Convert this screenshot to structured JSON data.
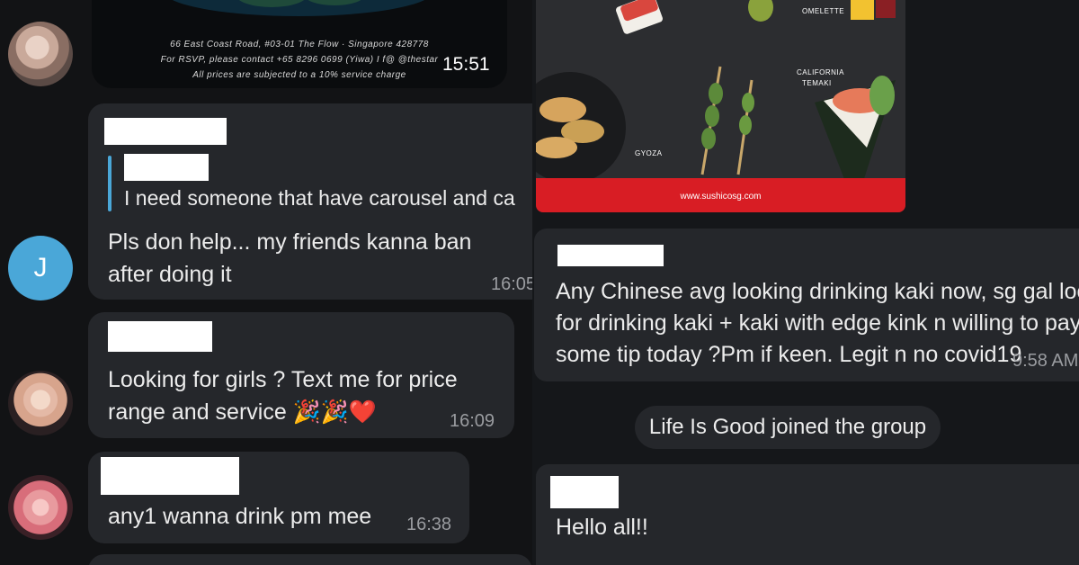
{
  "left_chat": {
    "media_card": {
      "address": "66 East Coast Road, #03-01 The Flow · Singapore 428778",
      "rsvp": "For RSVP, please contact +65 8296 0699 (Yiwa) I f@ @thestar",
      "service_charge": "All prices are subjected to a 10% service charge",
      "time": "15:51"
    },
    "messages": [
      {
        "avatar_letter": "J",
        "quote_text": "I need someone that have carousel and ca",
        "line1": "Pls don help... my friends kanna ban",
        "line2": "after doing it",
        "time": "16:05"
      },
      {
        "line1": "Looking for girls ? Text me for price",
        "line2": "range and service 🎉🎉❤️",
        "time": "16:09"
      },
      {
        "line1": "any1 wanna drink pm mee",
        "time": "16:38"
      }
    ]
  },
  "right_chat": {
    "poster": {
      "label_omelette": "OMELETTE",
      "label_california": "CALIFORNIA",
      "label_temaki": "TEMAKI",
      "label_gyoza": "GYOZA",
      "url": "www.sushicosg.com"
    },
    "message1": {
      "line1": "Any Chinese avg looking drinking kaki now, sg gal looking",
      "line2": "for drinking kaki + kaki with edge kink n willing to pay",
      "line3": "some tip today ?Pm if keen. Legit n no covid19",
      "time": "9:58 AM"
    },
    "system_message": "Life Is Good joined the group",
    "message2": {
      "text": "Hello all!!"
    }
  },
  "colors": {
    "bubble": "#25272b",
    "background": "#121315",
    "accent": "#4aa7d8",
    "poster_red": "#d81d24"
  }
}
